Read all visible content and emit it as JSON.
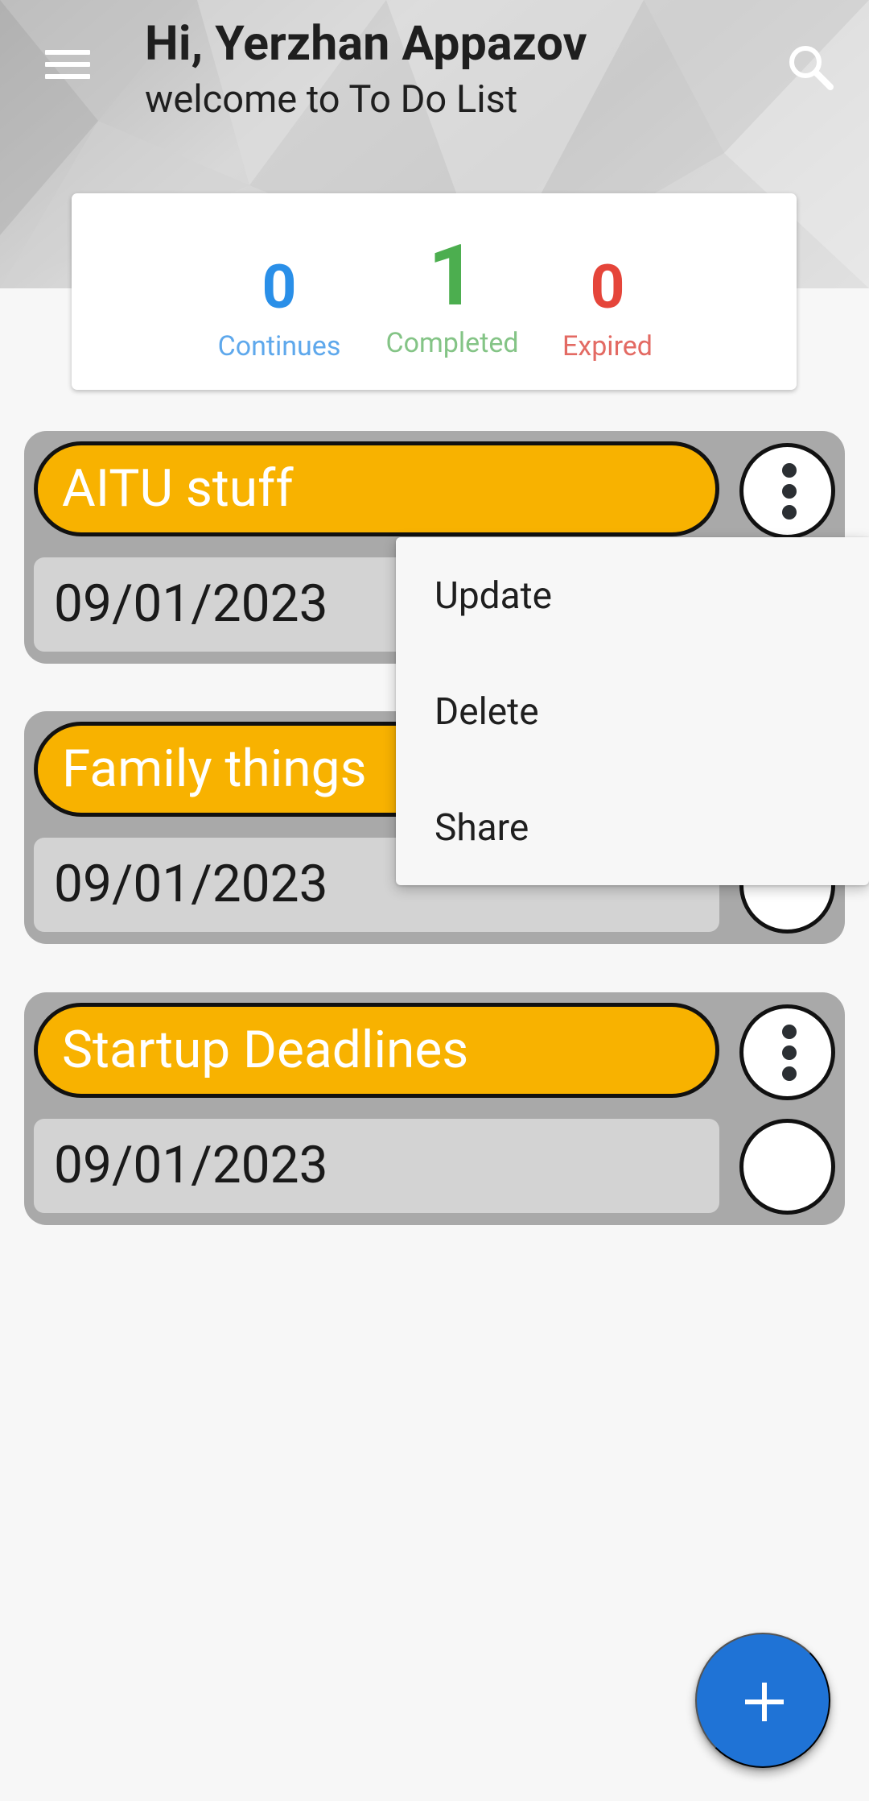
{
  "header": {
    "greeting": "Hi, Yerzhan Appazov",
    "subtitle": "welcome to To Do List",
    "menu_icon": "hamburger-menu-icon",
    "search_icon": "search-icon",
    "background_colors": [
      "#b6b6b6",
      "#d8d8d8",
      "#e6e6e6"
    ]
  },
  "stats": {
    "continues": {
      "value": "0",
      "label": "Continues",
      "color": "#2a8fe8"
    },
    "completed": {
      "value": "1",
      "label": "Completed",
      "color": "#4cae4f"
    },
    "expired": {
      "value": "0",
      "label": "Expired",
      "color": "#e5453a"
    }
  },
  "tasks": [
    {
      "title": "AITU stuff",
      "date": "09/01/2023",
      "more_icon": "more-vertical-icon"
    },
    {
      "title": "Family things",
      "date": "09/01/2023",
      "more_icon": "more-vertical-icon"
    },
    {
      "title": "Startup Deadlines",
      "date": "09/01/2023",
      "more_icon": "more-vertical-icon"
    }
  ],
  "popup_menu": {
    "items": [
      {
        "label": "Update"
      },
      {
        "label": "Delete"
      },
      {
        "label": "Share"
      }
    ]
  },
  "fab": {
    "icon": "plus-icon",
    "color": "#1f73d6"
  },
  "colors": {
    "task_card": "#a9a9a9",
    "task_title": "#f8b200",
    "task_date": "#d3d3d3"
  }
}
